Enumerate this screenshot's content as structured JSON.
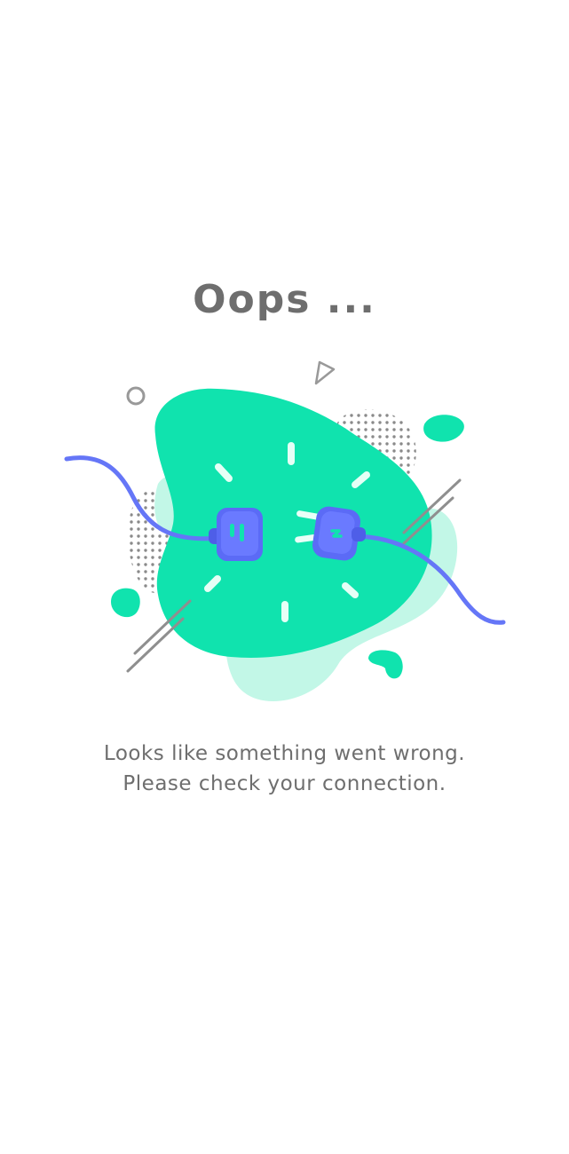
{
  "error_screen": {
    "title": "Oops ...",
    "message_line1": "Looks like something went wrong.",
    "message_line2": "Please check your connection."
  },
  "illustration": {
    "icon": "disconnected-plug-icon"
  },
  "colors": {
    "text": "#6e6e6e",
    "blob": "#10e3ae",
    "blob_light": "#c2f7e7",
    "plug": "#5b6bf6",
    "cable": "#6576f7",
    "dots": "#8a8a8a",
    "lines": "#8f8f8f"
  }
}
